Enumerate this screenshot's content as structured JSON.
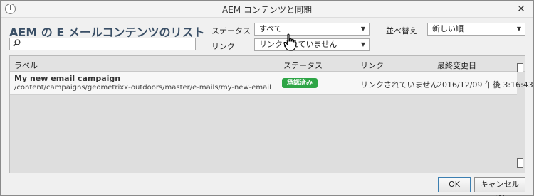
{
  "window": {
    "title": "AEM コンテンツと同期",
    "close_glyph": "✕",
    "app_icon": "info-icon"
  },
  "heading": "AEM の E メールコンテンツのリスト",
  "search": {
    "value": "",
    "placeholder": "",
    "icon": "search-icon"
  },
  "filters": {
    "status_label": "ステータス",
    "status_value": "すべて",
    "link_label": "リンク",
    "link_value": "リンクされていません",
    "sort_label": "並べ替え",
    "sort_value": "新しい順"
  },
  "table": {
    "columns": [
      "ラベル",
      "ステータス",
      "リンク",
      "最終変更日"
    ],
    "rows": [
      {
        "title": "My new email campaign",
        "path": "/content/campaigns/geometrixx-outdoors/master/e-mails/my-new-email",
        "status": "承認済み",
        "link": "リンクされていません",
        "modified": "2016/12/09 午後 3:16:43"
      }
    ]
  },
  "buttons": {
    "ok_label": "OK",
    "cancel_label": "キャンセル(A)"
  },
  "colors": {
    "heading": "#3a4f66",
    "approved_badge": "#2ea546"
  }
}
